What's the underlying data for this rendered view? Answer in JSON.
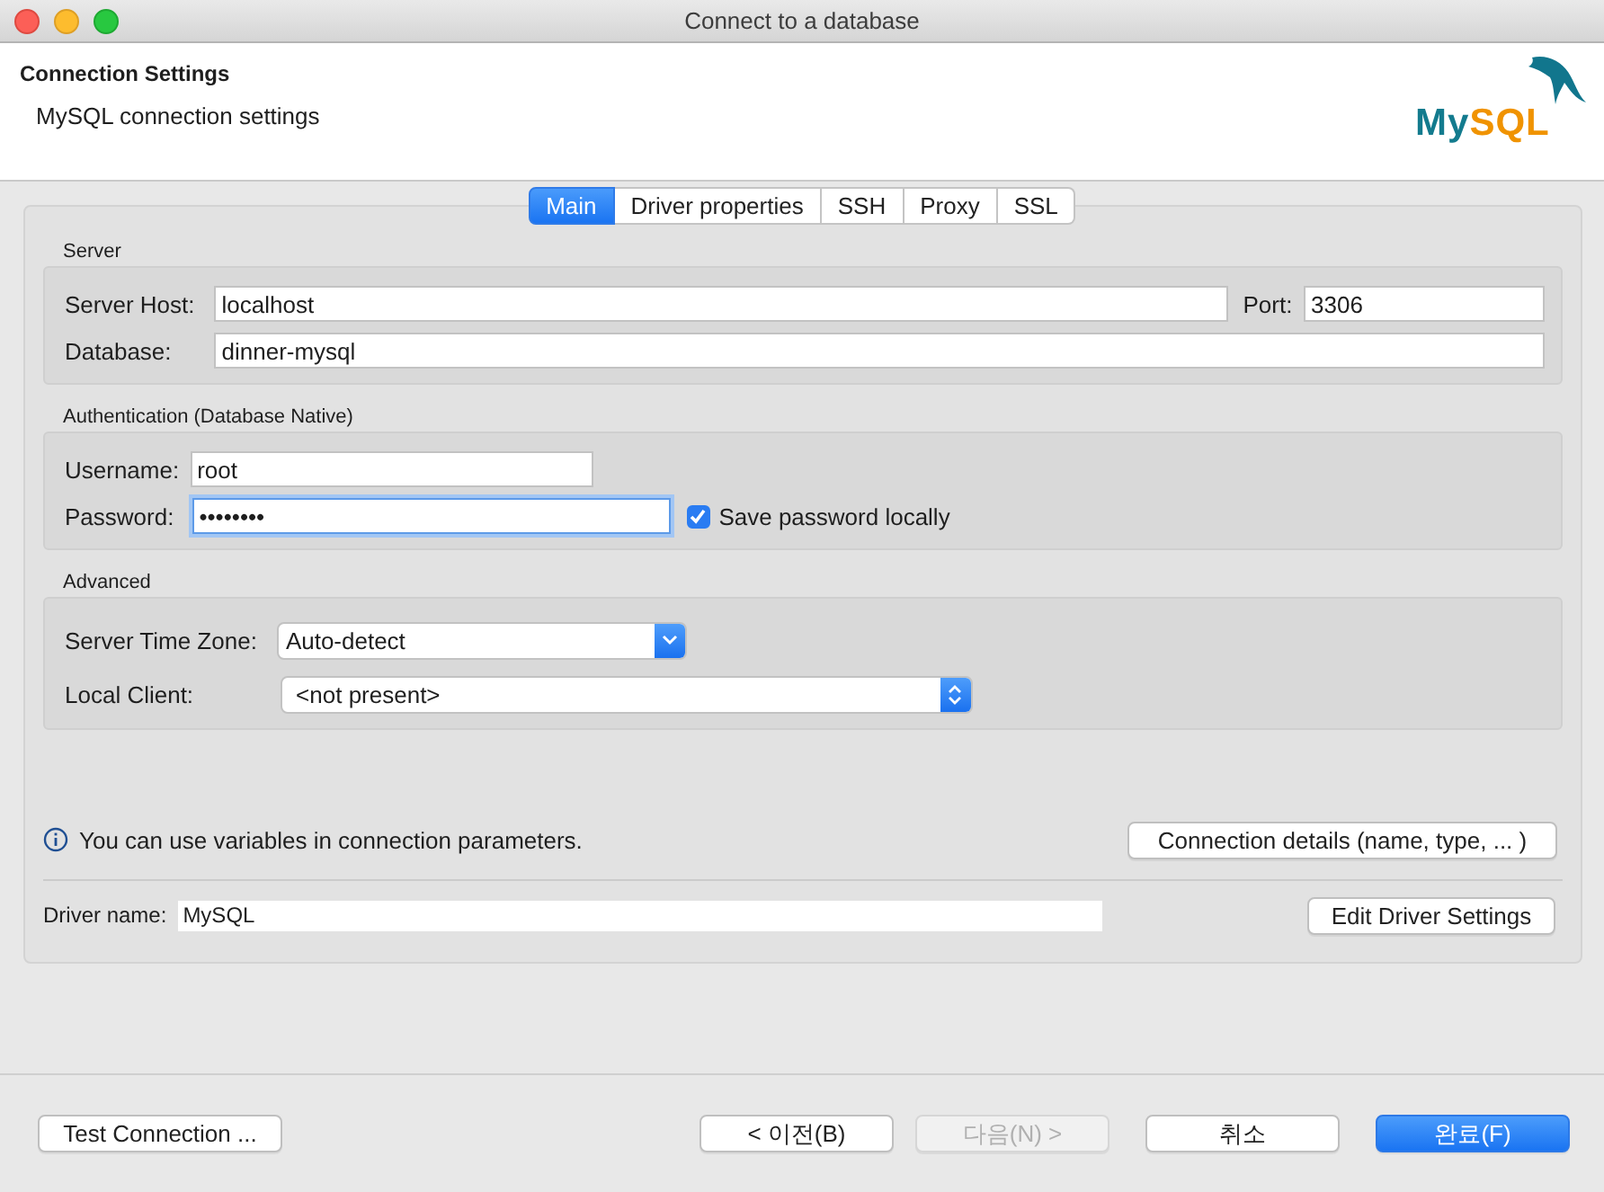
{
  "window": {
    "title": "Connect to a database"
  },
  "header": {
    "title": "Connection Settings",
    "subtitle": "MySQL connection settings",
    "logo": [
      "My",
      "SQL"
    ]
  },
  "tabs": [
    {
      "label": "Main",
      "selected": true
    },
    {
      "label": "Driver properties",
      "selected": false
    },
    {
      "label": "SSH",
      "selected": false
    },
    {
      "label": "Proxy",
      "selected": false
    },
    {
      "label": "SSL",
      "selected": false
    }
  ],
  "server": {
    "title": "Server",
    "host": {
      "label": "Server Host:",
      "value": "localhost"
    },
    "port": {
      "label": "Port:",
      "value": "3306"
    },
    "database": {
      "label": "Database:",
      "value": "dinner-mysql"
    }
  },
  "auth": {
    "title": "Authentication (Database Native)",
    "username": {
      "label": "Username:",
      "value": "root",
      "focused": false
    },
    "password": {
      "label": "Password:",
      "value": "••••••••",
      "focused": true
    },
    "save_password": {
      "label": "Save password locally",
      "checked": true
    }
  },
  "advanced": {
    "title": "Advanced",
    "selects": [
      {
        "label": "Server Time Zone:",
        "value": "Auto-detect",
        "kind": "dropdown"
      },
      {
        "label": "Local Client:",
        "value": "<not present>",
        "kind": "popup"
      }
    ]
  },
  "info": {
    "text": "You can use variables in connection parameters.",
    "button": "Connection details (name, type, ... )"
  },
  "driver": {
    "label": "Driver name:",
    "value": "MySQL",
    "button": "Edit Driver Settings"
  },
  "footer": [
    {
      "label": "Test Connection ...",
      "kind": "normal",
      "disabled": false
    },
    {
      "label": "< 이전(B)",
      "kind": "normal",
      "disabled": false
    },
    {
      "label": "다음(N) >",
      "kind": "normal",
      "disabled": true
    },
    {
      "label": "취소",
      "kind": "normal",
      "disabled": false
    },
    {
      "label": "완료(F)",
      "kind": "primary",
      "disabled": false
    }
  ]
}
